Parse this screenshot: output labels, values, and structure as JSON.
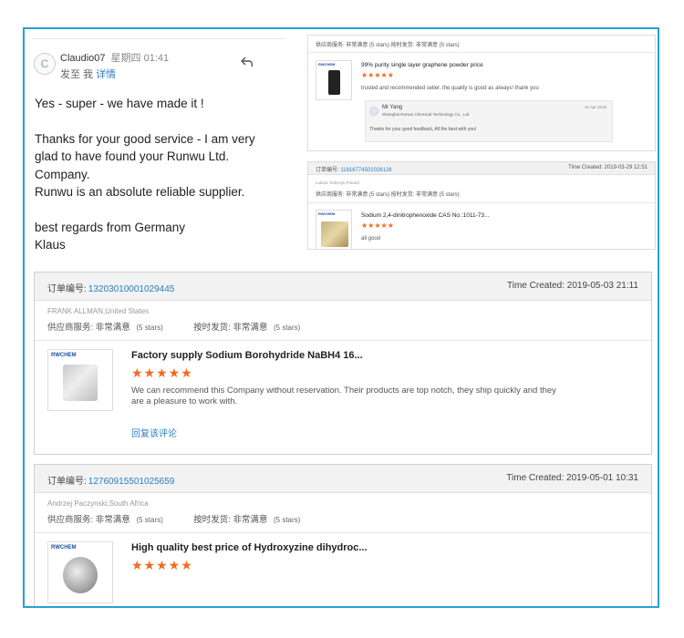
{
  "email": {
    "avatar_letter": "C",
    "sender": "Claudio07",
    "time": "星期四 01:41",
    "to_label": "发至 我",
    "detail_link": "详情",
    "body": [
      "Yes - super - we have made it !",
      "",
      "Thanks for your good service - I am very",
      "glad to have found your Runwu Ltd.",
      "Company.",
      "Runwu is an absolute reliable supplier.",
      "",
      "best regards from Germany",
      "Klaus"
    ]
  },
  "mini1": {
    "ratings": "供应商服务: 非常满意  (5 stars)      按时发货: 非常满意  (5 stars)",
    "product_title": "99% purity single layer graphene powder price",
    "stars": "★★★★★",
    "comment": "trusted and recommended seller. the quality is good as always! thank you",
    "reply_name": "Mr Yang",
    "reply_company": "Shanghai Runwu Chemical Technology Co., Ltd",
    "reply_date": "11 Apr 2019",
    "reply_text": "Thanks for your good feedback, All the best with you!",
    "brand": "RWCHEM"
  },
  "mini2": {
    "order_label": "订单编号:",
    "order_no": "11816774501026126",
    "time_created": "Time Created: 2019-03-29 12:51",
    "buyer": "Lukasz Sobczyk,Poland",
    "ratings": "供应商服务: 非常满意  (5 stars)      按时发货: 非常满意  (5 stars)",
    "product_title": "Sodium 2,4-dinitrophenoxide CAS No.:1011-73...",
    "stars": "★★★★★",
    "comment": "all good",
    "brand": "RWCHEM"
  },
  "cards": [
    {
      "order_label": "订单编号:",
      "order_no": "13203010001029445",
      "time_created": "Time Created: 2019-05-03 21:11",
      "buyer": "FRANK ALLMAN,United States",
      "service_label": "供应商服务:",
      "service_value": "非常满意",
      "service_stars": "(5 stars)",
      "ship_label": "按时发货:",
      "ship_value": "非常满意",
      "ship_stars": "(5 stars)",
      "brand": "RWCHEM",
      "product_title": "Factory supply Sodium Borohydride NaBH4 16...",
      "stars": "★★★★★",
      "comment": "We can recommend this Company without reservation.  Their products are top notch, they ship quickly and they are a pleasure to work with.",
      "reply_link": "回复该评论"
    },
    {
      "order_label": "订单编号:",
      "order_no": "12760915501025659",
      "time_created": "Time Created: 2019-05-01 10:31",
      "buyer": "Andrzej Paczynski,South Africa",
      "service_label": "供应商服务:",
      "service_value": "非常满意",
      "service_stars": "(5 stars)",
      "ship_label": "按时发货:",
      "ship_value": "非常满意",
      "ship_stars": "(5 stars)",
      "brand": "RWCHEM",
      "product_title": "High quality best price of Hydroxyzine dihydroc...",
      "stars": "★★★★★"
    }
  ]
}
